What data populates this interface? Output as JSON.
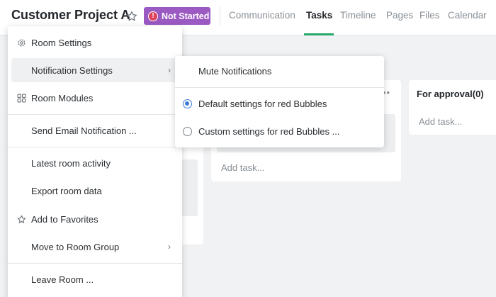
{
  "header": {
    "project_title": "Customer Project A",
    "status_label": "Not Started",
    "status_color": "#9b59c2",
    "tabs": [
      {
        "label": "Communication",
        "active": false
      },
      {
        "label": "Tasks",
        "active": true
      },
      {
        "label": "Timeline",
        "active": false
      },
      {
        "label": "Pages",
        "active": false
      },
      {
        "label": "Files",
        "active": false
      },
      {
        "label": "Calendar",
        "active": false
      }
    ],
    "active_tab_color": "#26a86b"
  },
  "board": {
    "columns": [
      {
        "title": "",
        "add_task": ""
      },
      {
        "title": "",
        "add_task": "Add task..."
      },
      {
        "title": "For approval(0)",
        "add_task": "Add task..."
      }
    ]
  },
  "menu": {
    "items": [
      {
        "label": "Room Settings",
        "icon": "gear-icon"
      },
      {
        "label": "Notification Settings",
        "icon": "",
        "has_submenu": true,
        "highlighted": true
      },
      {
        "label": "Room Modules",
        "icon": "modules-grid-icon"
      },
      {
        "label": "Send Email Notification ...",
        "icon": ""
      },
      {
        "label": "Latest room activity",
        "icon": ""
      },
      {
        "label": "Export room data",
        "icon": ""
      },
      {
        "label": "Add to Favorites",
        "icon": "star-icon"
      },
      {
        "label": "Move to Room Group",
        "icon": "",
        "has_submenu": true
      },
      {
        "label": "Leave Room ...",
        "icon": ""
      }
    ]
  },
  "submenu": {
    "mute_label": "Mute Notifications",
    "options": [
      {
        "label": "Default settings for red Bubbles",
        "checked": true
      },
      {
        "label": "Custom settings for red Bubbles ...",
        "checked": false
      }
    ],
    "radio_color": "#3a7bd5"
  }
}
